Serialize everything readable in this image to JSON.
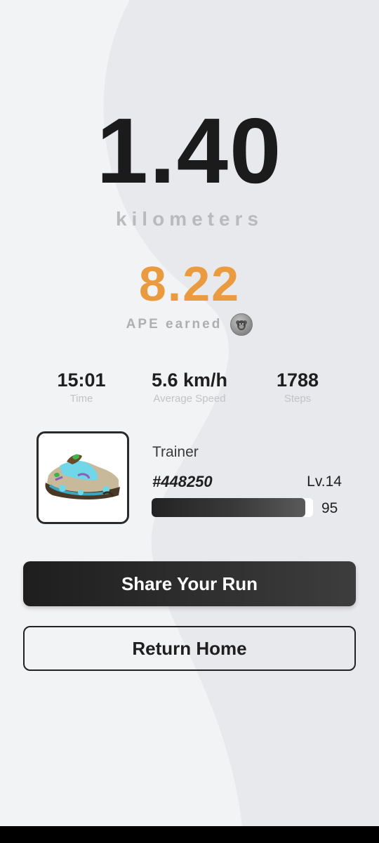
{
  "run": {
    "distance": "1.40",
    "distance_unit": "kilometers"
  },
  "earnings": {
    "amount": "8.22",
    "label": "APE earned",
    "token_icon": "ape-coin-icon"
  },
  "stats": [
    {
      "value": "15:01",
      "label": "Time"
    },
    {
      "value": "5.6 km/h",
      "label": "Average Speed"
    },
    {
      "value": "1788",
      "label": "Steps"
    }
  ],
  "trainer": {
    "label": "Trainer",
    "token_id": "#448250",
    "level": "Lv.14",
    "durability": 95,
    "durability_label": "95",
    "image": "sneaker-image"
  },
  "actions": {
    "share_label": "Share Your Run",
    "home_label": "Return Home"
  },
  "colors": {
    "accent": "#eb9b3f",
    "primary_text": "#1b1b1b",
    "muted_text": "#b9babd",
    "background": "#f2f3f5"
  }
}
